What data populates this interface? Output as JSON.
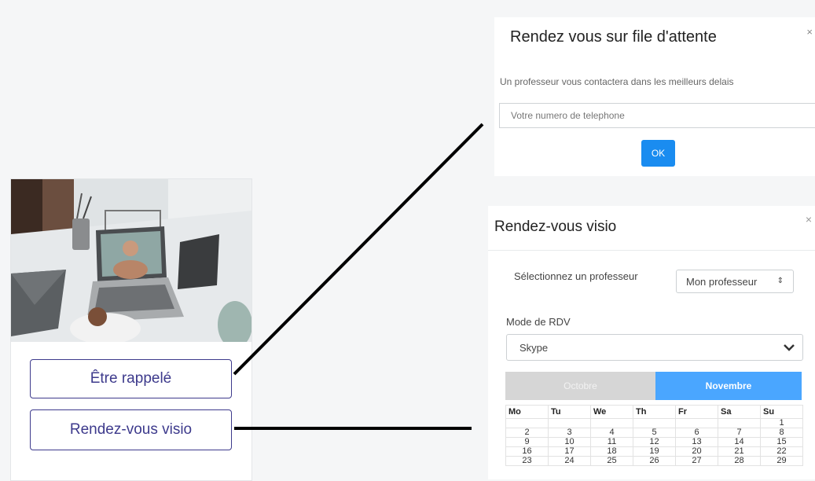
{
  "card": {
    "photo_alt": "laptop-video-call-photo",
    "callback_button": "Être rappelé",
    "visio_button": "Rendez-vous visio"
  },
  "queue_modal": {
    "title": "Rendez vous sur file d'attente",
    "close": "×",
    "description": "Un professeur vous contactera dans les meilleurs delais",
    "phone_placeholder": "Votre numero de telephone",
    "ok_label": "OK"
  },
  "visio_modal": {
    "title": "Rendez-vous visio",
    "close": "×",
    "teacher_label": "Sélectionnez un professeur",
    "teacher_value": "Mon professeur",
    "mode_label": "Mode de RDV",
    "mode_value": "Skype",
    "months": [
      "Octobre",
      "Novembre"
    ],
    "weekdays": [
      "Mo",
      "Tu",
      "We",
      "Th",
      "Fr",
      "Sa",
      "Su"
    ],
    "weeks": [
      [
        "",
        "",
        "",
        "",
        "",
        "",
        "1"
      ],
      [
        "2",
        "3",
        "4",
        "5",
        "6",
        "7",
        "8"
      ],
      [
        "9",
        "10",
        "11",
        "12",
        "13",
        "14",
        "15"
      ],
      [
        "16",
        "17",
        "18",
        "19",
        "20",
        "21",
        "22"
      ],
      [
        "23",
        "24",
        "25",
        "26",
        "27",
        "28",
        "29"
      ]
    ]
  },
  "colors": {
    "primary_blue": "#1a8cf0",
    "month_active": "#4aa6ff",
    "month_inactive": "#d6d6d6",
    "outline_button": "#3d3a8c"
  }
}
